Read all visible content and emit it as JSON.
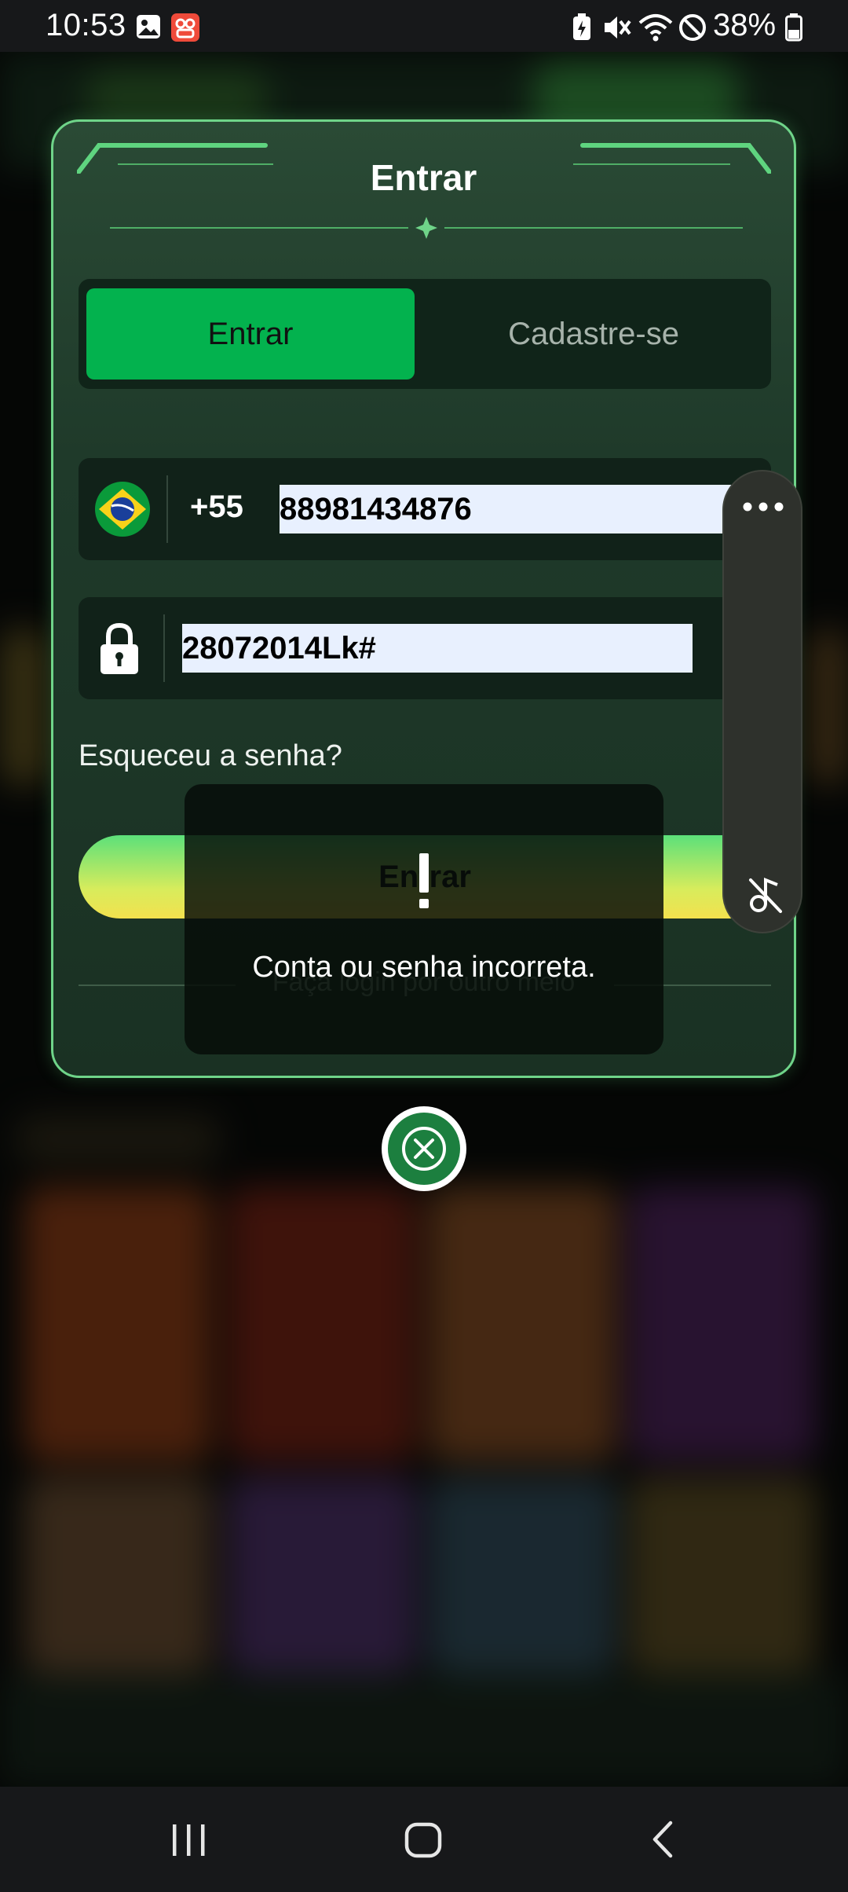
{
  "status_bar": {
    "time": "10:53",
    "battery": "38%",
    "icons": [
      "gallery-icon",
      "notification-app-icon",
      "battery-saver-icon",
      "vibrate-icon",
      "wifi-icon",
      "do-not-disturb-icon",
      "battery-icon"
    ]
  },
  "modal": {
    "title": "Entrar",
    "tabs": [
      {
        "label": "Entrar",
        "active": true
      },
      {
        "label": "Cadastre-se",
        "active": false
      }
    ],
    "phone": {
      "country_code": "+55",
      "value": "88981434876",
      "flag": "brazil-flag-icon"
    },
    "password": {
      "value": "28072014Lk#"
    },
    "forgot_password": "Esqueceu a senha?",
    "submit_label": "Entrar",
    "other_login": "Faça login por outro meio"
  },
  "toast": {
    "message": "Conta ou senha incorreta."
  },
  "colors": {
    "accent_green": "#03b24e",
    "modal_border": "#6fd489",
    "close_button": "#1c7f3f"
  }
}
